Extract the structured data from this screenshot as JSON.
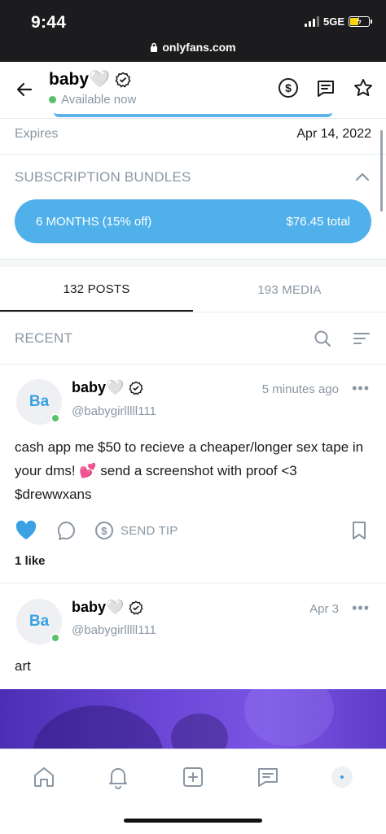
{
  "status_bar": {
    "time": "9:44",
    "network": "5GE",
    "url": "onlyfans.com"
  },
  "profile": {
    "name": "baby🤍",
    "status": "Available now"
  },
  "subscription": {
    "expires_label": "Expires",
    "expires_value": "Apr 14, 2022",
    "bundles_label": "SUBSCRIPTION BUNDLES",
    "bundle": {
      "label": "6 MONTHS (15% off)",
      "price": "$76.45 total"
    }
  },
  "tabs": [
    {
      "label": "132 POSTS",
      "active": true
    },
    {
      "label": "193 MEDIA",
      "active": false
    }
  ],
  "feed": {
    "section_label": "RECENT"
  },
  "posts": [
    {
      "avatar_initials": "Ba",
      "name": "baby🤍",
      "handle": "@babygirlllll111",
      "time": "5 minutes ago",
      "text": "cash app me $50 to recieve a cheaper/longer sex tape in your dms! 💕 send a screenshot with proof <3 $drewwxans",
      "tip_label": "SEND TIP",
      "likes": "1 like"
    },
    {
      "avatar_initials": "Ba",
      "name": "baby🤍",
      "handle": "@babygirlllll111",
      "time": "Apr 3",
      "text": "art"
    }
  ],
  "colors": {
    "accent": "#4fb0ea",
    "muted": "#8a96a3",
    "online": "#57c16a",
    "like": "#3aa1e3"
  },
  "icons": {
    "header": [
      "dollar-circle-icon",
      "message-icon",
      "star-icon"
    ],
    "nav": [
      "home-icon",
      "bell-icon",
      "plus-square-icon",
      "chat-icon",
      "profile-avatar"
    ]
  }
}
